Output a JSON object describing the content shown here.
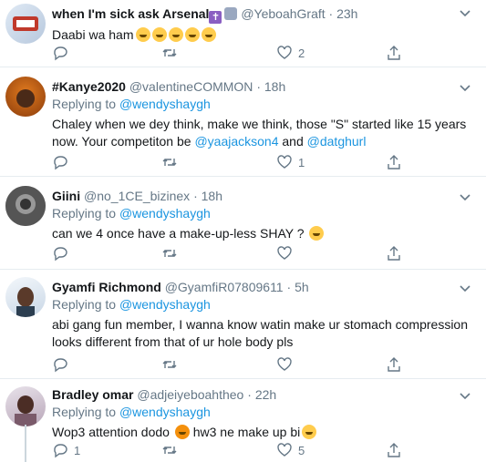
{
  "tweets": [
    {
      "name": "when I'm sick ask Arsenal",
      "handle": "@YeboahGraft",
      "sep": "·",
      "time": "23h",
      "text": "Daabi wa ham",
      "counts": {
        "reply": "",
        "retweet": "",
        "like": "2",
        "share": ""
      }
    },
    {
      "name": "#Kanye2020",
      "handle": "@valentineCOMMON",
      "sep": "·",
      "time": "18h",
      "replying_prefix": "Replying to ",
      "replying_to": "@wendyshaygh",
      "text_line1": "Chaley when we dey think, make we think, those \"S\" started like 15 years",
      "text_line2_a": "now. Your competiton be ",
      "mention1": "@yaajackson4",
      "text_and": " and ",
      "mention2": "@datghurl",
      "counts": {
        "reply": "",
        "retweet": "",
        "like": "1",
        "share": ""
      }
    },
    {
      "name": "Giini",
      "handle": "@no_1CE_bizinex",
      "sep": "·",
      "time": "18h",
      "replying_prefix": "Replying to ",
      "replying_to": "@wendyshaygh",
      "text": "can we 4 once have a make-up-less SHAY ?",
      "counts": {
        "reply": "",
        "retweet": "",
        "like": "",
        "share": ""
      }
    },
    {
      "name": "Gyamfi Richmond",
      "handle": "@GyamfiR07809611",
      "sep": "·",
      "time": "5h",
      "replying_prefix": "Replying to ",
      "replying_to": "@wendyshaygh",
      "text_line1": "abi gang fun member, I wanna know watin make ur stomach compression",
      "text_line2": "looks different from that of ur hole body pls",
      "counts": {
        "reply": "",
        "retweet": "",
        "like": "",
        "share": ""
      }
    },
    {
      "name": "Bradley omar",
      "handle": "@adjeiyeboahtheo",
      "sep": "·",
      "time": "22h",
      "replying_prefix": "Replying to ",
      "replying_to": "@wendyshaygh",
      "text_a": "Wop3 attention dodo",
      "text_b": "hw3 ne make up bi",
      "counts": {
        "reply": "1",
        "retweet": "",
        "like": "5",
        "share": ""
      }
    }
  ],
  "icons": {
    "reply": "reply-icon",
    "retweet": "retweet-icon",
    "like": "like-icon",
    "share": "share-icon",
    "more": "chevron-down-icon"
  },
  "colors": {
    "link": "#1b95e0",
    "muted": "#657786",
    "divider": "#e6ecf0"
  }
}
